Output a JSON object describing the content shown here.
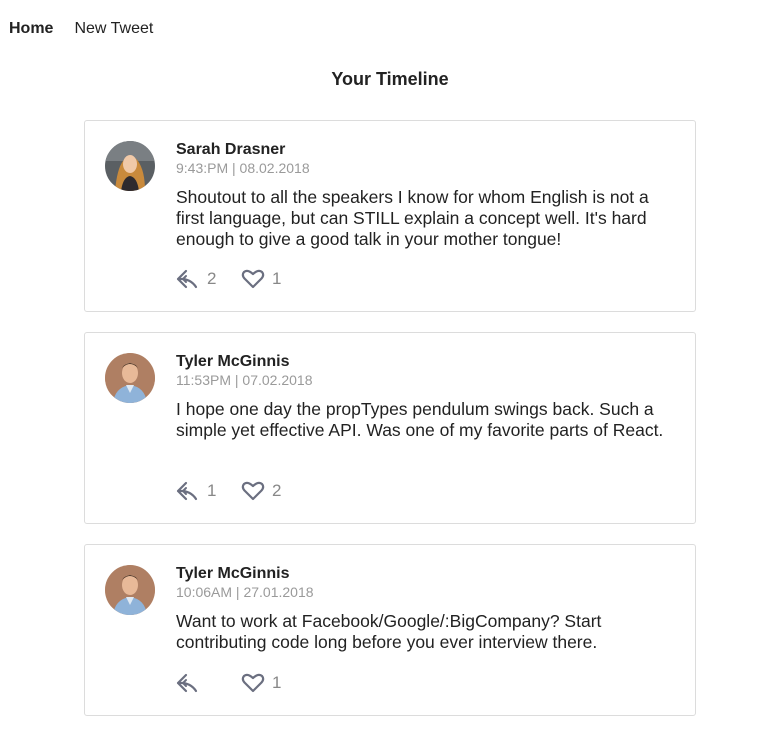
{
  "nav": {
    "home_label": "Home",
    "new_tweet_label": "New Tweet"
  },
  "page": {
    "title": "Your Timeline"
  },
  "tweets": [
    {
      "author": "Sarah Drasner",
      "timestamp": "9:43:PM | 08.02.2018",
      "text": "Shoutout to all the speakers I know for whom English is not a first language, but can STILL explain a concept well. It's hard enough to give a good talk in your mother tongue!",
      "replies": "2",
      "likes": "1"
    },
    {
      "author": "Tyler McGinnis",
      "timestamp": "11:53PM | 07.02.2018",
      "text": "I hope one day the propTypes pendulum swings back. Such a simple yet effective API. Was one of my favorite parts of React.",
      "replies": "1",
      "likes": "2"
    },
    {
      "author": "Tyler McGinnis",
      "timestamp": "10:06AM | 27.01.2018",
      "text": "Want to work at Facebook/Google/:BigCompany? Start contributing code long before you ever interview there.",
      "replies": "",
      "likes": "1"
    }
  ],
  "icons": {
    "reply": "reply-arrow-icon",
    "like": "heart-outline-icon"
  },
  "colors": {
    "icon": "#6b6f80",
    "muted_text": "#9a9a9a",
    "border": "#dcdcdc"
  }
}
